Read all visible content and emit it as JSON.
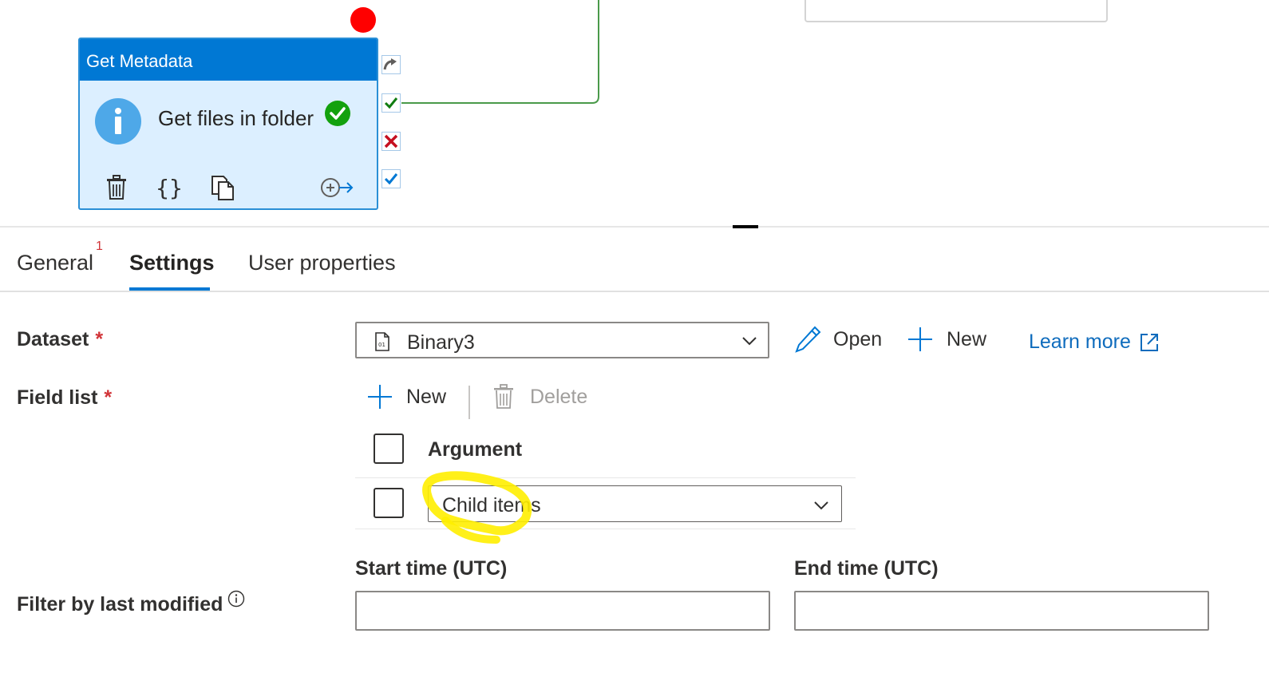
{
  "canvas": {
    "activity": {
      "type_label": "Get Metadata",
      "name": "Get files in folder",
      "actions": [
        "delete-icon",
        "code-icon",
        "copy-icon",
        "add-output-icon"
      ]
    },
    "output_ports": [
      "skipped-arrow-icon",
      "success-check-icon",
      "failure-x-icon",
      "completion-check-icon"
    ]
  },
  "tabs": {
    "general": "General",
    "general_badge": "1",
    "settings": "Settings",
    "user_properties": "User properties",
    "active": "Settings"
  },
  "settings": {
    "dataset": {
      "label": "Dataset",
      "required_mark": "*",
      "value": "Binary3",
      "open_label": "Open",
      "new_label": "New",
      "learn_more_label": "Learn more"
    },
    "field_list": {
      "label": "Field list",
      "required_mark": "*",
      "new_label": "New",
      "delete_label": "Delete",
      "column_header": "Argument",
      "rows": [
        {
          "argument": "Child items"
        }
      ]
    },
    "filter": {
      "label": "Filter by last modified",
      "start_label": "Start time (UTC)",
      "end_label": "End time (UTC)",
      "start_value": "",
      "end_value": ""
    }
  },
  "colors": {
    "accent": "#0078d4",
    "activity_body": "#dcefff",
    "error_dot": "#ff0000",
    "required": "#d13438",
    "success": "#13a10e",
    "highlight": "#ffee00"
  }
}
